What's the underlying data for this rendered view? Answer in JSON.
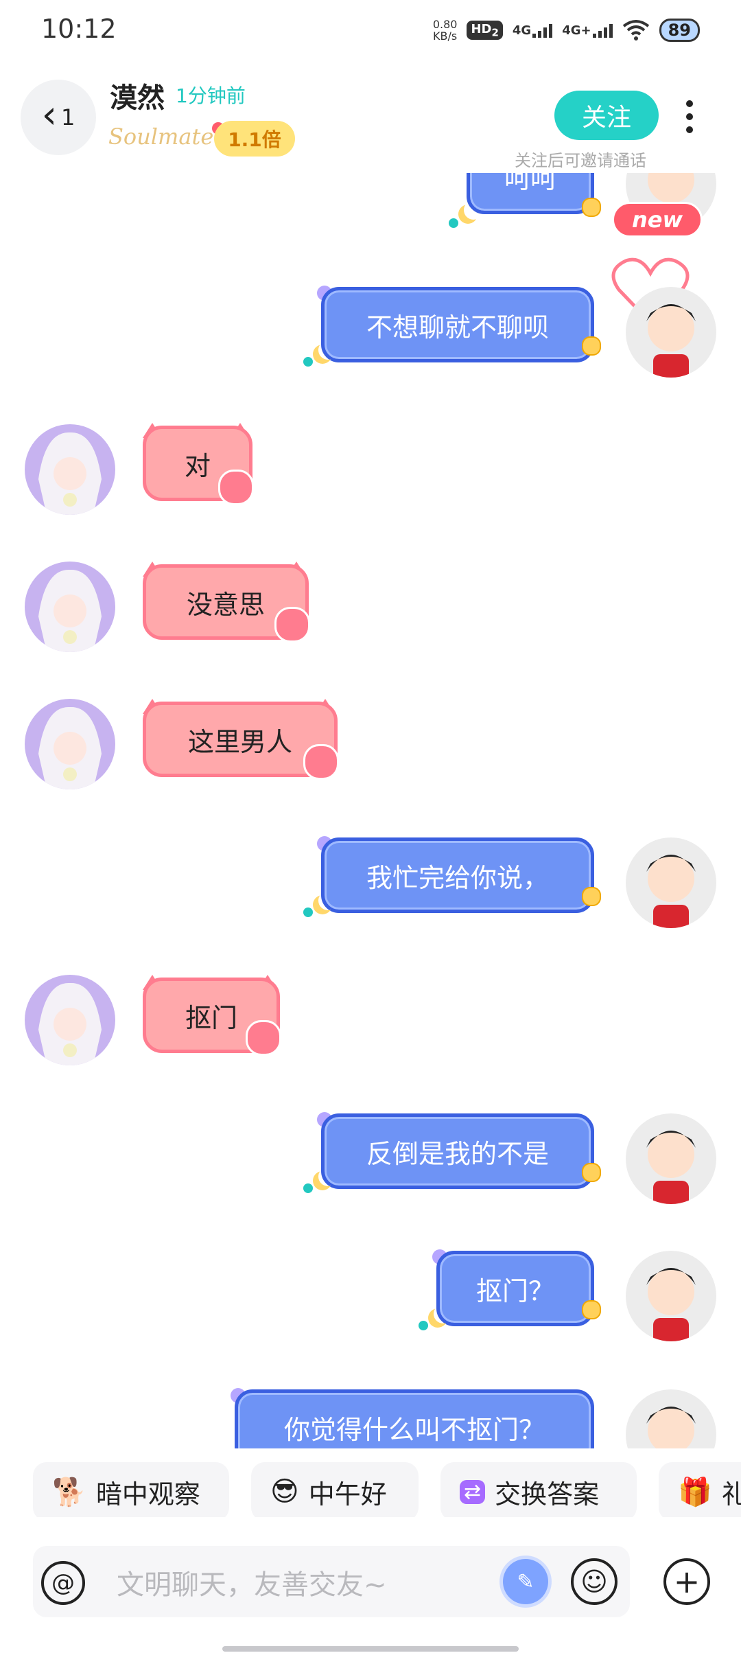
{
  "status_bar": {
    "time": "10:12",
    "net_speed_value": "0.80",
    "net_speed_unit": "KB/s",
    "hd_label": "HD",
    "sim2": "2",
    "sig1_label": "4G",
    "sig2_label": "4G+",
    "battery": "89"
  },
  "header": {
    "back_count": "1",
    "contact_name": "漠然",
    "last_seen": "1分钟前",
    "soulmate_label": "Soulmate",
    "multiplier": "1.1倍",
    "follow_label": "关注",
    "follow_hint": "关注后可邀请通话"
  },
  "messages": [
    {
      "from": "me",
      "text": "呵呵"
    },
    {
      "from": "me",
      "text": "不想聊就不聊呗"
    },
    {
      "from": "her",
      "text": "对"
    },
    {
      "from": "her",
      "text": "没意思"
    },
    {
      "from": "her",
      "text": "这里男人"
    },
    {
      "from": "me",
      "text": "我忙完给你说，"
    },
    {
      "from": "her",
      "text": "抠门"
    },
    {
      "from": "me",
      "text": "反倒是我的不是"
    },
    {
      "from": "me",
      "text": "抠门？"
    },
    {
      "from": "me",
      "text": "你觉得什么叫不抠门？"
    }
  ],
  "badges": {
    "new": "new"
  },
  "quick_replies": [
    {
      "label": "暗中观察",
      "icon": "🐕"
    },
    {
      "label": "中午好",
      "icon": "😎"
    },
    {
      "label": "交换答案",
      "icon": "⇄"
    },
    {
      "label": "礼",
      "icon": "🎁"
    }
  ],
  "input": {
    "placeholder": "文明聊天，友善交友~"
  }
}
